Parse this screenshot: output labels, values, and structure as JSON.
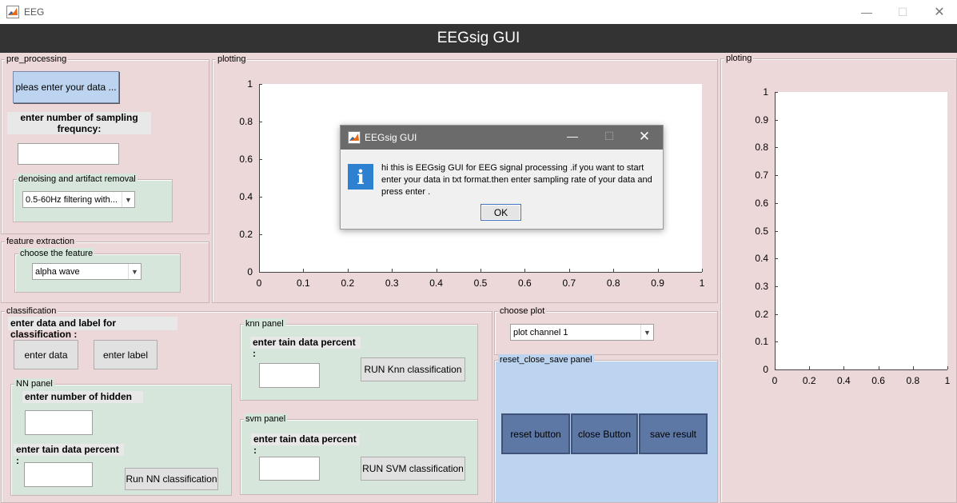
{
  "window": {
    "title": "EEG",
    "minimize_glyph": "—",
    "maximize_glyph": "☐",
    "close_glyph": "✕"
  },
  "header": {
    "title": "EEGsig GUI"
  },
  "pre_processing": {
    "title": "pre_processing",
    "enter_data_button": "pleas enter your data ...",
    "sampling_label": "enter number of sampling frequncy:",
    "sampling_value": "",
    "denoise_panel_title": "denoising and artifact removal",
    "denoise_selected": "0.5-60Hz filtering with..."
  },
  "feature_extraction": {
    "title": "feature extraction",
    "choose_panel_title": "choose the feature",
    "feature_selected": "alpha wave"
  },
  "plot1": {
    "title": "plotting",
    "x_ticks": [
      "0",
      "0.1",
      "0.2",
      "0.3",
      "0.4",
      "0.5",
      "0.6",
      "0.7",
      "0.8",
      "0.9",
      "1"
    ],
    "y_ticks": [
      "0",
      "0.2",
      "0.4",
      "0.6",
      "0.8",
      "1"
    ]
  },
  "plot2": {
    "title": "ploting",
    "x_ticks": [
      "0",
      "0.2",
      "0.4",
      "0.6",
      "0.8",
      "1"
    ],
    "y_ticks": [
      "0",
      "0.1",
      "0.2",
      "0.3",
      "0.4",
      "0.5",
      "0.6",
      "0.7",
      "0.8",
      "0.9",
      "1"
    ]
  },
  "classification": {
    "title": "classification",
    "heading": "enter data and label for classification :",
    "enter_data_button": "enter data",
    "enter_label_button": "enter label",
    "nn_panel": {
      "title": "NN panel",
      "hidden_label": "enter number of hidden",
      "hidden_value": "",
      "percent_label": "enter tain data percent :",
      "percent_value": "",
      "run_button": "Run NN classification"
    },
    "knn_panel": {
      "title": "knn panel",
      "percent_label": "enter tain data percent :",
      "percent_value": "",
      "run_button": "RUN Knn classification"
    },
    "svm_panel": {
      "title": "svm panel",
      "percent_label": "enter tain data percent :",
      "percent_value": "",
      "run_button": "RUN SVM classification"
    }
  },
  "choose_plot": {
    "title": "choose plot",
    "selected": "plot channel 1"
  },
  "reset_panel": {
    "title": "reset_close_save panel",
    "reset_button": "reset button",
    "close_button": "close Button",
    "save_button": "save result"
  },
  "dialog": {
    "title": "EEGsig GUI",
    "message": "hi this is EEGsig GUI for EEG signal processing .if you want to start enter your data in txt format.then enter sampling rate of your data and press enter .",
    "ok_button": "OK",
    "icon": "info-icon",
    "minimize_glyph": "—",
    "maximize_glyph": "☐",
    "close_glyph": "✕"
  }
}
